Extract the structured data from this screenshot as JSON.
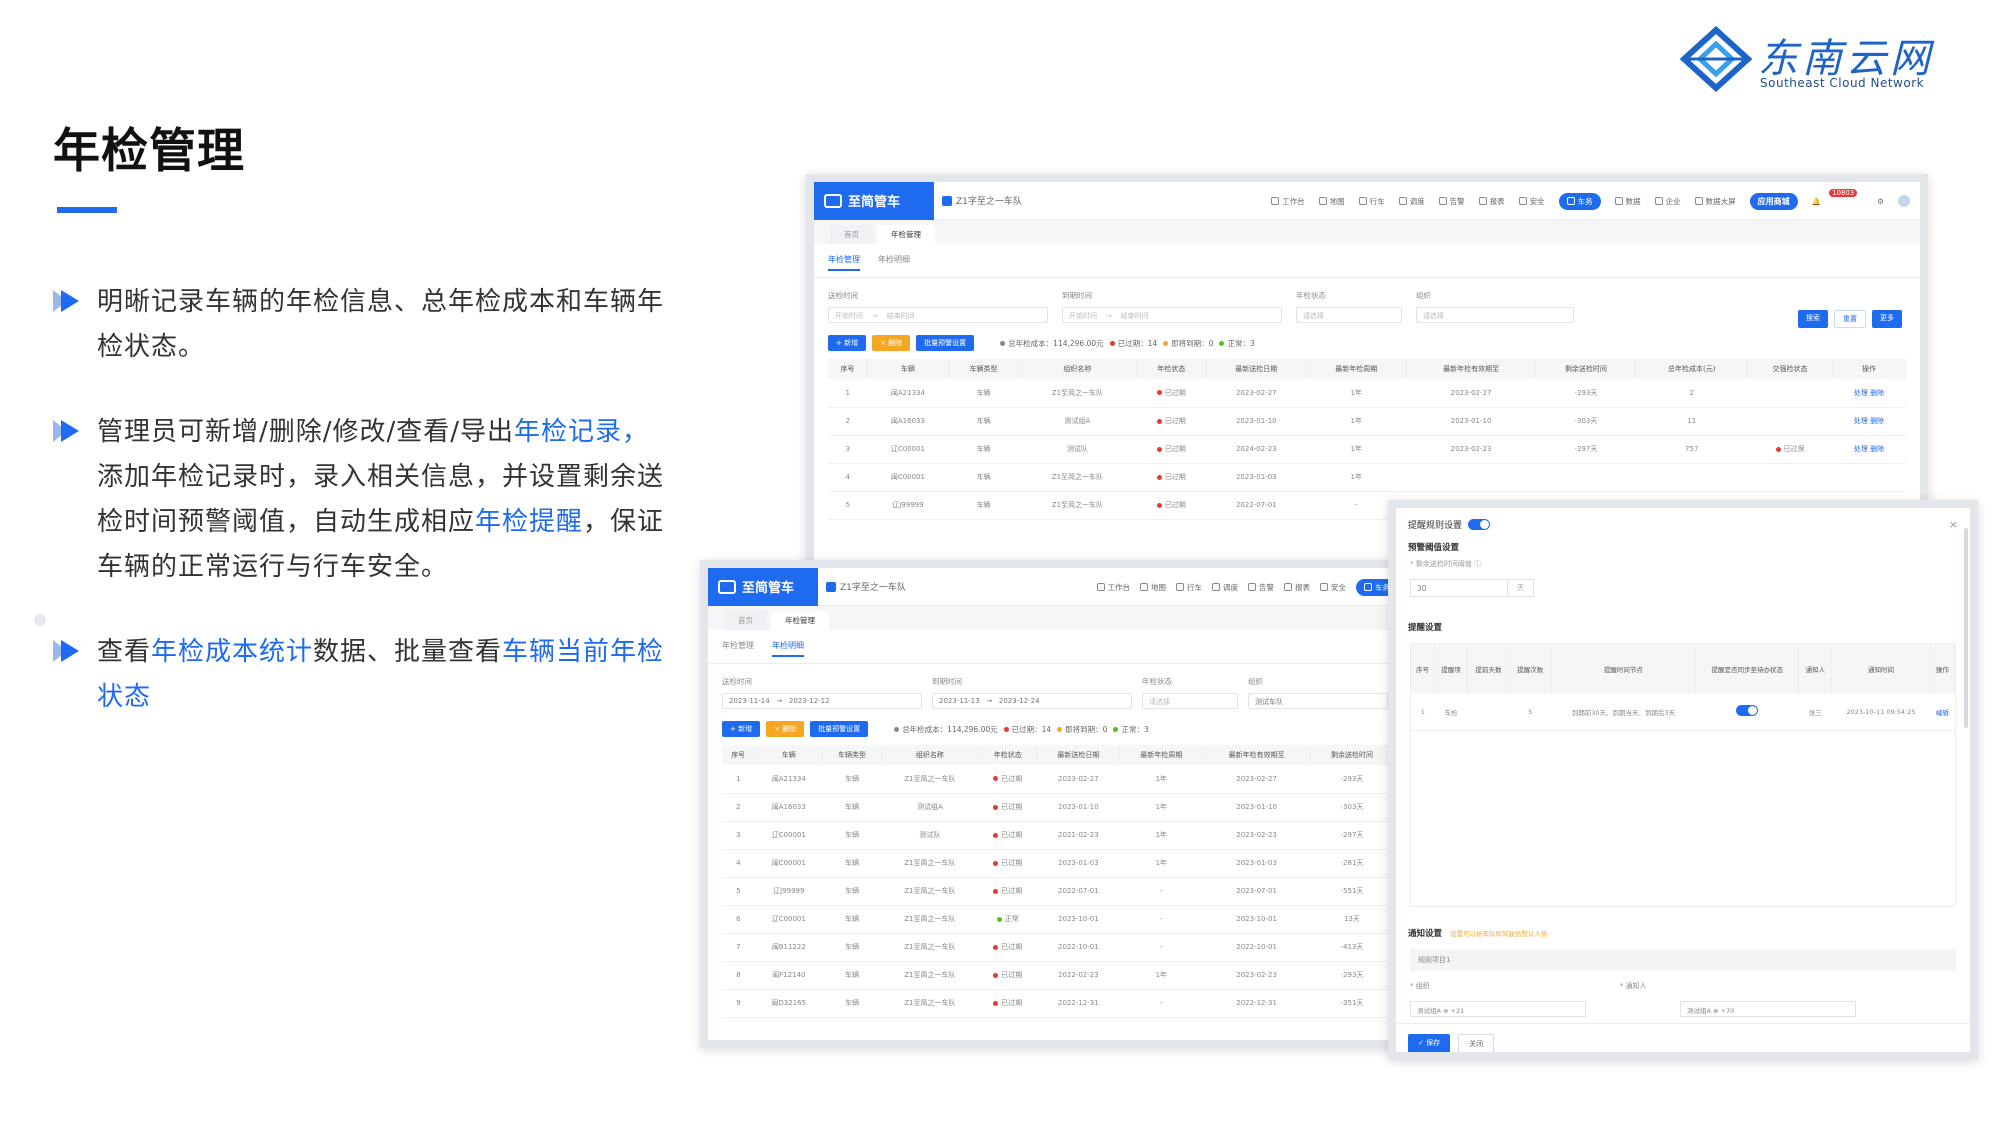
{
  "slide": {
    "title": "年检管理",
    "bullets": [
      {
        "parts": [
          {
            "t": "明晰记录车辆的年检信息、总年检成本和车辆年检状态。",
            "hl": false
          }
        ]
      },
      {
        "parts": [
          {
            "t": "管理员可新增/删除/修改/查看/导出",
            "hl": false
          },
          {
            "t": "年检记录，",
            "hl": true
          },
          {
            "t": "添加年检记录时，录入相关信息，并设置剩余送检时间预警阈值，自动生成相应",
            "hl": false
          },
          {
            "t": "年检提醒",
            "hl": true
          },
          {
            "t": "，保证车辆的正常运行与行车安全。",
            "hl": false
          }
        ]
      },
      {
        "parts": [
          {
            "t": "查看",
            "hl": false
          },
          {
            "t": "年检成本统计",
            "hl": true
          },
          {
            "t": "数据、批量查看",
            "hl": false
          },
          {
            "t": "车辆当前年检状态",
            "hl": true
          }
        ]
      }
    ]
  },
  "logo": {
    "cn": "东南云网",
    "en": "Southeast Cloud Network"
  },
  "app": {
    "brand": "至简管车",
    "team": "Z1字至之一车队",
    "nav": [
      "工作台",
      "地图",
      "行车",
      "调度",
      "告警",
      "报表",
      "安全",
      "车务",
      "数据",
      "企业",
      "数据大屏"
    ],
    "active_nav": "车务",
    "app_store": "应用商城",
    "badge": "10803"
  },
  "w1": {
    "page_tabs": [
      "首页",
      "年检管理"
    ],
    "sub_tabs": [
      "年检管理",
      "年检明细"
    ],
    "filters": [
      {
        "label": "送检时间",
        "value": "开始时间",
        "value2": "结束时间"
      },
      {
        "label": "到期时间",
        "value": "开始时间",
        "value2": "结束时间"
      },
      {
        "label": "年检状态",
        "value": "请选择"
      },
      {
        "label": "组织",
        "value": "请选择"
      }
    ],
    "search_btns": [
      "搜索",
      "重置",
      "更多"
    ],
    "actions": [
      "+ 新增",
      "× 删除",
      "批量预警设置"
    ],
    "stats": [
      {
        "text": "总年检成本：114,296.00元",
        "color": "#888"
      },
      {
        "text": "已过期：14",
        "color": "#e53935"
      },
      {
        "text": "即将到期：0",
        "color": "#f5a623"
      },
      {
        "text": "正常：3",
        "color": "#52c41a"
      }
    ],
    "columns": [
      "序号",
      "车辆",
      "车辆类型",
      "组织名称",
      "年检状态",
      "最新送检日期",
      "最新年检周期",
      "最新年检有效期至",
      "剩余送检时间",
      "总年检成本(元)",
      "交强险状态",
      "操作"
    ],
    "rows": [
      [
        "1",
        "闽A21334",
        "车辆",
        "Z1至简之一车队",
        "已过期",
        "2023-02-27",
        "1年",
        "2023-02-27",
        "-293天",
        "2",
        "",
        "处理 删除"
      ],
      [
        "2",
        "闽A16033",
        "车辆",
        "测试组A",
        "已过期",
        "2023-01-10",
        "1年",
        "2023-01-10",
        "-303天",
        "11",
        "",
        "处理 删除"
      ],
      [
        "3",
        "辽C00001",
        "车辆",
        "测试队",
        "已过期",
        "2024-02-23",
        "1年",
        "2023-02-23",
        "-297天",
        "757",
        "已过保",
        "处理 删除"
      ],
      [
        "4",
        "闽C00001",
        "车辆",
        "Z1至简之一车队",
        "已过期",
        "2023-01-03",
        "1年",
        "",
        "",
        "",
        "",
        ""
      ],
      [
        "5",
        "辽J99999",
        "车辆",
        "Z1至简之一车队",
        "已过期",
        "2022-07-01",
        "-",
        "",
        "",
        "",
        "",
        ""
      ]
    ]
  },
  "w2": {
    "page_tabs": [
      "首页",
      "年检管理"
    ],
    "sub_tabs": [
      "年检管理",
      "年检明细"
    ],
    "filters": [
      {
        "label": "送检时间",
        "value": "2023-11-14",
        "value2": "2023-12-12"
      },
      {
        "label": "到期时间",
        "value": "2023-11-13",
        "value2": "2023-12-24"
      },
      {
        "label": "年检状态",
        "value": "请选择"
      },
      {
        "label": "组织",
        "value": "测试车队"
      }
    ],
    "actions": [
      "+ 新增",
      "× 删除",
      "批量预警设置"
    ],
    "stats": [
      {
        "text": "总年检成本：114,296.00元",
        "color": "#888"
      },
      {
        "text": "已过期：14",
        "color": "#e53935"
      },
      {
        "text": "即将到期：0",
        "color": "#f5a623"
      },
      {
        "text": "正常：3",
        "color": "#52c41a"
      }
    ],
    "columns": [
      "序号",
      "车辆",
      "车辆类型",
      "组织名称",
      "年检状态",
      "最新送检日期",
      "最新年检周期",
      "最新年检有效期至",
      "剩余送检时间"
    ],
    "rows": [
      [
        "1",
        "闽A21334",
        "车辆",
        "Z1至简之一车队",
        "已过期",
        "2023-02-27",
        "1年",
        "2023-02-27",
        "-293天"
      ],
      [
        "2",
        "闽A16033",
        "车辆",
        "测试组A",
        "已过期",
        "2023-01-10",
        "1年",
        "2023-01-10",
        "-303天"
      ],
      [
        "3",
        "辽C00001",
        "车辆",
        "测试队",
        "已过期",
        "2021-02-23",
        "1年",
        "2023-02-23",
        "-297天"
      ],
      [
        "4",
        "闽C00001",
        "车辆",
        "Z1至简之一车队",
        "已过期",
        "2023-01-03",
        "1年",
        "2023-01-03",
        "-281天"
      ],
      [
        "5",
        "辽J99999",
        "车辆",
        "Z1至简之一车队",
        "已过期",
        "2022-07-01",
        "-",
        "2023-07-01",
        "-551天"
      ],
      [
        "6",
        "辽C00001",
        "车辆",
        "Z1至简之一车队",
        "正常",
        "2023-10-01",
        "-",
        "2023-10-01",
        "13天"
      ],
      [
        "7",
        "闽B11222",
        "车辆",
        "Z1至简之一车队",
        "已过期",
        "2022-10-01",
        "-",
        "2022-10-01",
        "-413天"
      ],
      [
        "8",
        "闽F12140",
        "车辆",
        "Z1至简之一车队",
        "已过期",
        "2022-02-23",
        "1年",
        "2023-02-23",
        "-293天"
      ],
      [
        "9",
        "闽D32165",
        "车辆",
        "Z1至简之一车队",
        "已过期",
        "2022-12-31",
        "-",
        "2022-12-31",
        "-351天"
      ]
    ]
  },
  "w3": {
    "title": "提醒规则设置",
    "threshold_section": "预警阈值设置",
    "threshold_hint": "* 剩余送检时间阈值 ⓘ",
    "threshold_value": "30",
    "threshold_unit": "天",
    "reminder_section": "提醒设置",
    "columns": [
      "序号",
      "提醒项",
      "提前天数",
      "提醒次数",
      "提醒时间节点",
      "提醒是否同步至待办状态",
      "通知人",
      "通知时间",
      "操作"
    ],
    "row": [
      "1",
      "车检",
      "",
      "5",
      "到期前30天、到期当天、到期后3天",
      "",
      "张三",
      "2023-10-11 09:54:25",
      "编辑"
    ],
    "notify_section": "通知设置",
    "notify_warn": "设置可以给车队和驾驶员默认人员",
    "rule_name": "规则项目1",
    "org_label": "* 组织",
    "notifier_label": "* 通知人",
    "org_value": "测试组A ⊗   +21",
    "notifier_value": "测试组A ⊗   +70",
    "save": "✓ 保存",
    "cancel": "关闭"
  },
  "colors": {
    "accent": "#1e6bf0",
    "expired": "#e53935",
    "normal": "#52c41a",
    "warning": "#f5a623"
  }
}
